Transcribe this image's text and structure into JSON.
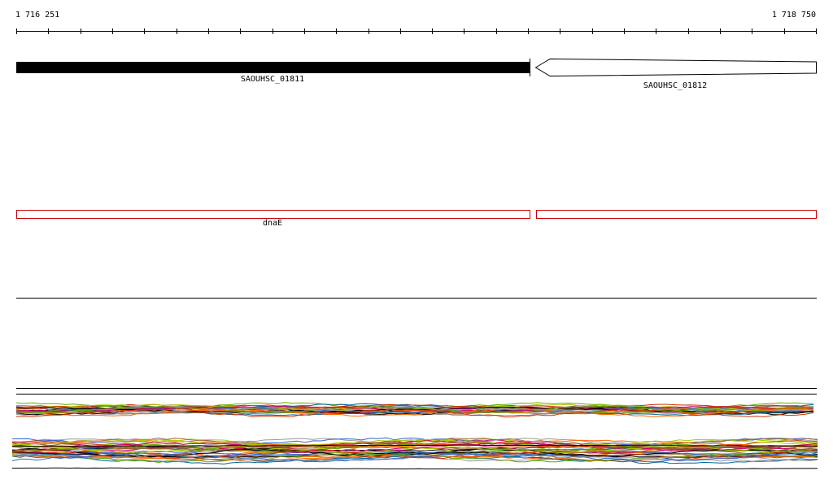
{
  "browser": {
    "coordinates": {
      "start": "1 716 251",
      "end": "1 718 750"
    },
    "genes": [
      {
        "id": "SAOUHSC_01811",
        "label": "SAOUHSC_01811",
        "strand": "+"
      },
      {
        "id": "SAOUHSC_01812",
        "label": "SAOUHSC_01812",
        "strand": "-"
      }
    ],
    "features": [
      {
        "label": "dnaE"
      },
      {
        "label": ""
      }
    ]
  },
  "colors": {
    "gene_fill": "#000000",
    "feature_outline": "#cc0000",
    "coverage_palette": [
      "#000000",
      "#cc3300",
      "#66aa00",
      "#ff6600",
      "#3366cc",
      "#996633",
      "#aacc00",
      "#cc0066",
      "#006699",
      "#999999"
    ]
  }
}
